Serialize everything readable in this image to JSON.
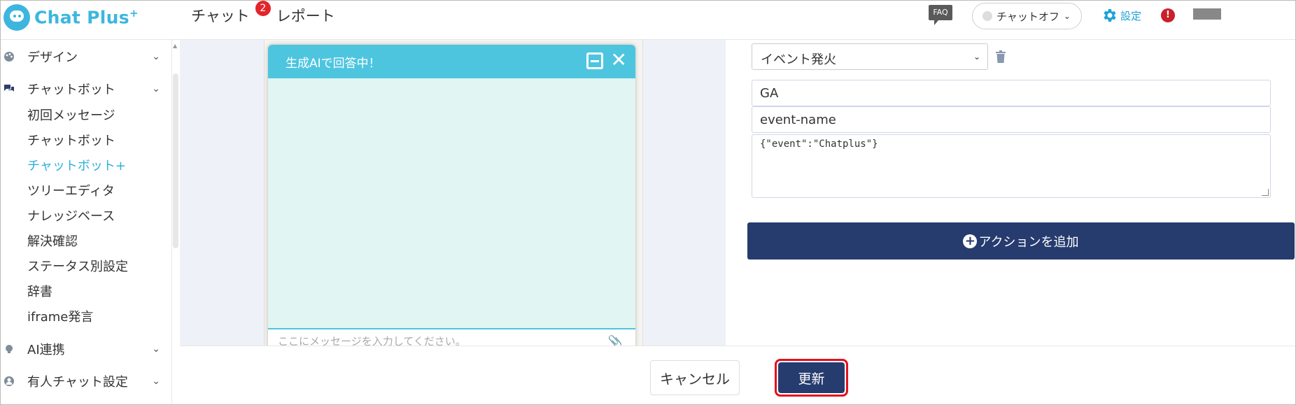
{
  "header": {
    "logo_text": "Chat Plus",
    "logo_plus": "+",
    "nav": [
      {
        "label": "チャット",
        "badge": "2"
      },
      {
        "label": "レポート"
      }
    ],
    "faq_label": "FAQ",
    "chat_status": "チャットオフ",
    "settings_label": "設定",
    "alert_symbol": "!"
  },
  "sidebar": {
    "sections": [
      {
        "label": "デザイン",
        "icon": "palette-icon"
      },
      {
        "label": "チャットボット",
        "icon": "chat-bubbles-icon"
      },
      {
        "label": "AI連携",
        "icon": "lightbulb-icon"
      },
      {
        "label": "有人チャット設定",
        "icon": "person-icon"
      }
    ],
    "chatbot_items": [
      {
        "label": "初回メッセージ"
      },
      {
        "label": "チャットボット"
      },
      {
        "label": "チャットボット+",
        "active": true
      },
      {
        "label": "ツリーエディタ"
      },
      {
        "label": "ナレッジベース"
      },
      {
        "label": "解決確認"
      },
      {
        "label": "ステータス別設定"
      },
      {
        "label": "辞書"
      },
      {
        "label": "iframe発言"
      }
    ]
  },
  "preview": {
    "title": "生成AIで回答中！",
    "input_placeholder": "ここにメッセージを入力してください。"
  },
  "action": {
    "type_selected": "イベント発火",
    "field_1": "GA",
    "field_2": "event-name",
    "field_3": "{\"event\":\"Chatplus\"}",
    "add_action_label": "アクションを追加"
  },
  "footer": {
    "cancel_label": "キャンセル",
    "update_label": "更新"
  },
  "colors": {
    "brand": "#3db6df",
    "navy": "#263b6e",
    "badge_red": "#e4242b",
    "highlight_red": "#e2111c",
    "active_link": "#30b0d9"
  }
}
